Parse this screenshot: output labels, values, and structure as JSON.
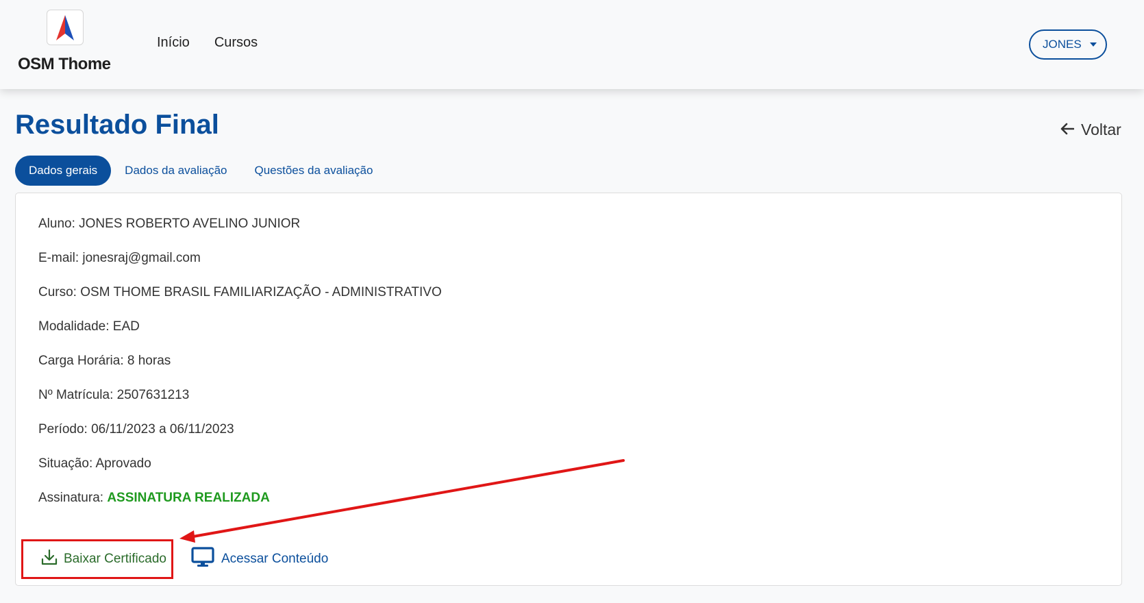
{
  "header": {
    "brand": "OSM Thome",
    "nav": [
      {
        "label": "Início"
      },
      {
        "label": "Cursos"
      }
    ],
    "user_menu": "JONES"
  },
  "page": {
    "title": "Resultado Final",
    "back_label": "Voltar"
  },
  "tabs": [
    {
      "label": "Dados gerais",
      "active": true
    },
    {
      "label": "Dados da avaliação",
      "active": false
    },
    {
      "label": "Questões da avaliação",
      "active": false
    }
  ],
  "details": {
    "aluno": "Aluno: JONES ROBERTO AVELINO JUNIOR",
    "email": "E-mail: jonesraj@gmail.com",
    "curso": "Curso: OSM THOME BRASIL FAMILIARIZAÇÃO - ADMINISTRATIVO",
    "modalidade": "Modalidade: EAD",
    "carga_horaria": "Carga Horária: 8 horas",
    "matricula": "Nº Matrícula: 2507631213",
    "periodo": "Período: 06/11/2023 a 06/11/2023",
    "situacao": "Situação: Aprovado",
    "assinatura_label": "Assinatura:",
    "assinatura_value": "ASSINATURA REALIZADA"
  },
  "actions": {
    "download_certificate": "Baixar Certificado",
    "access_content": "Acessar Conteúdo"
  },
  "colors": {
    "primary": "#0b4f9c",
    "success": "#1f9a1f",
    "highlight": "#e01616"
  },
  "icons": [
    "logo-icon",
    "caret-down-icon",
    "arrow-left-icon",
    "download-icon",
    "monitor-icon"
  ]
}
